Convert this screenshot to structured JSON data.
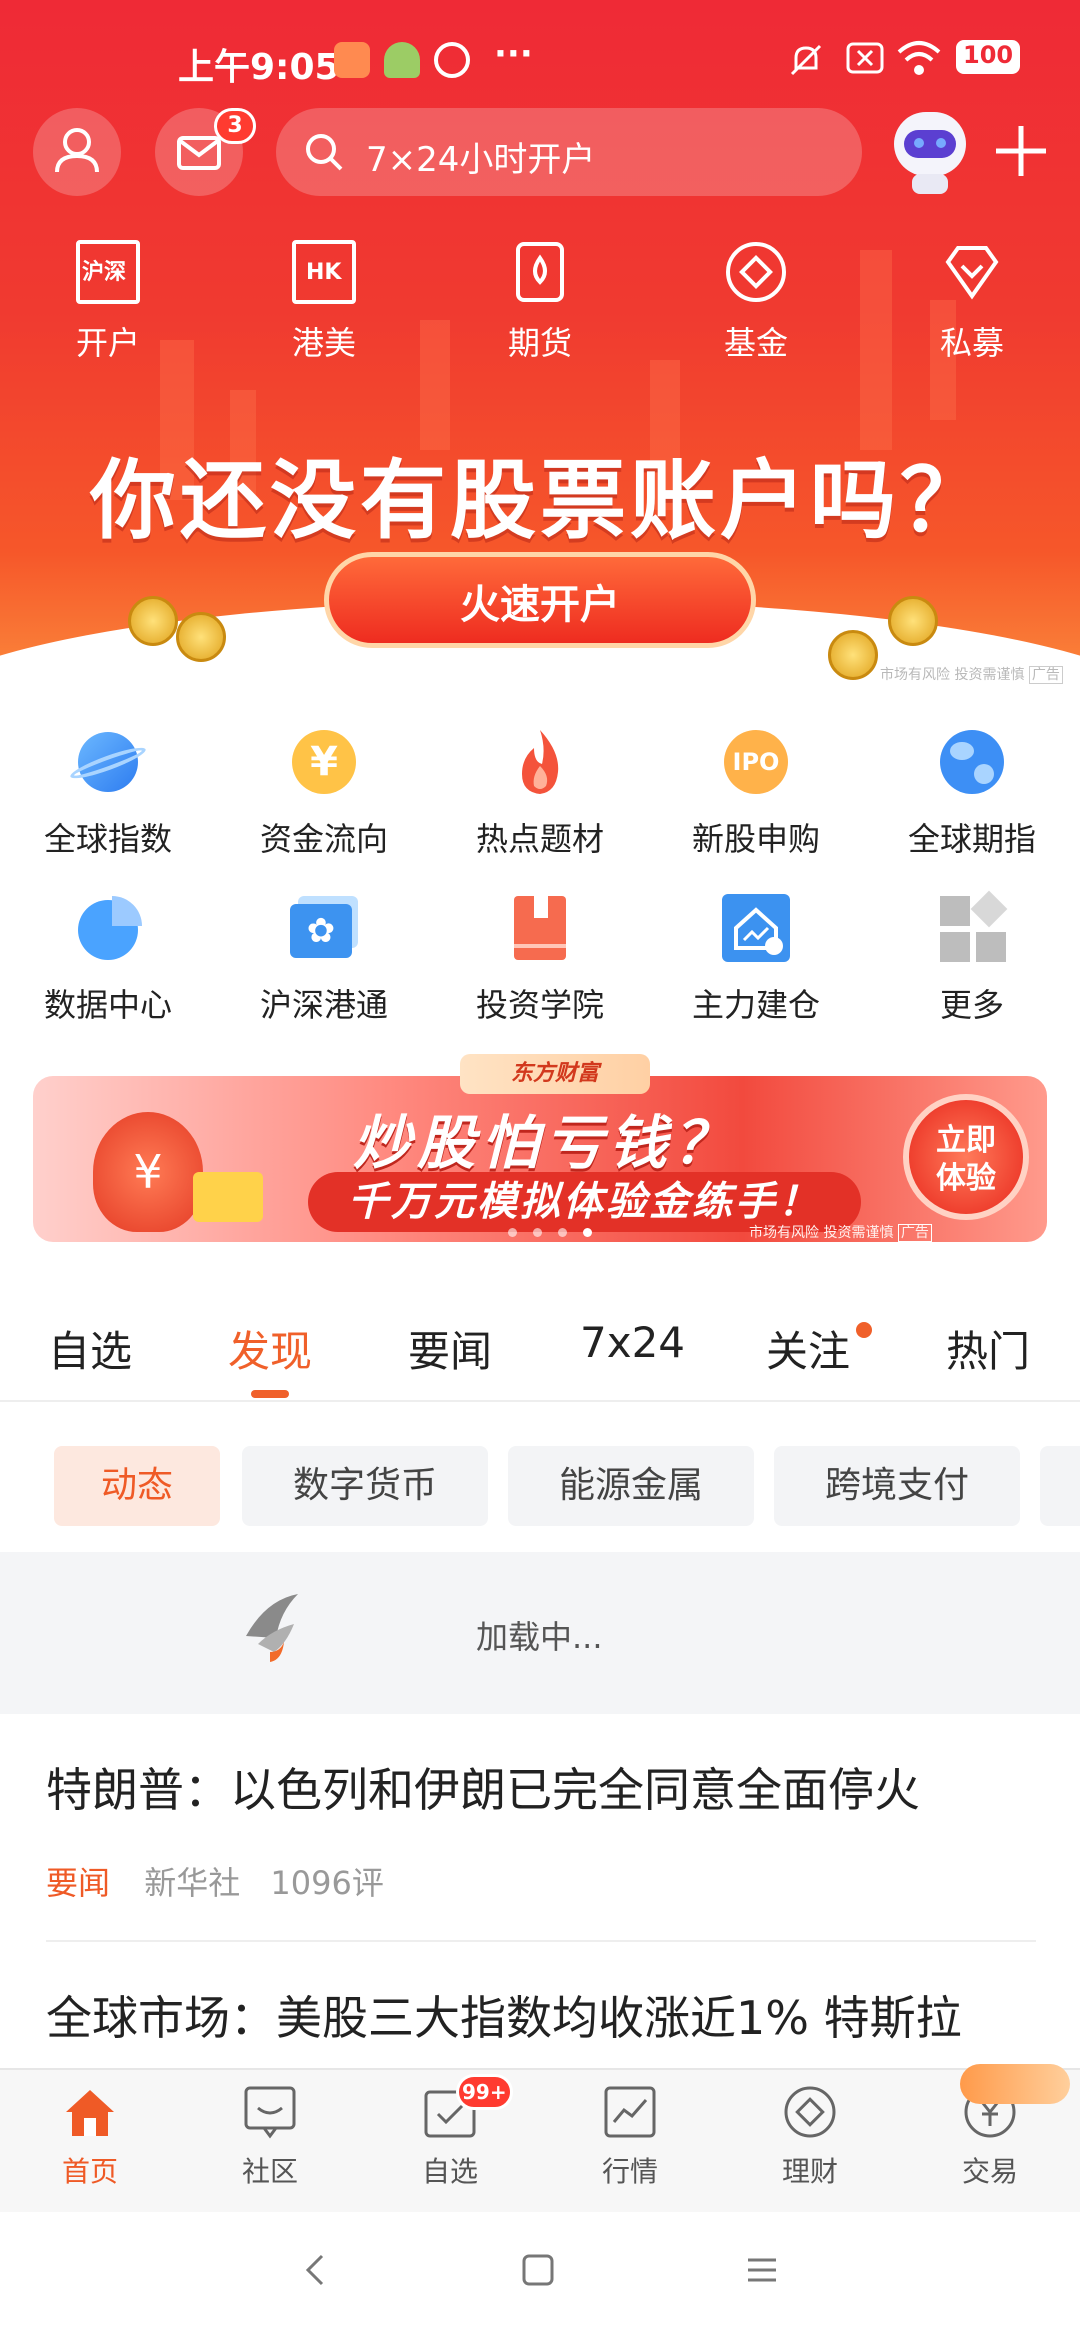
{
  "status_bar": {
    "time": "上午9:05",
    "dots": "···",
    "battery": "100"
  },
  "top_bar": {
    "mail_badge": "3",
    "search_placeholder": "7×24小时开户"
  },
  "quick_entries": [
    {
      "label": "开户",
      "icon": "sh-sz-account-icon",
      "icon_text": "沪深"
    },
    {
      "label": "港美",
      "icon": "hk-us-icon",
      "icon_text": "HK"
    },
    {
      "label": "期货",
      "icon": "futures-icon"
    },
    {
      "label": "基金",
      "icon": "fund-icon"
    },
    {
      "label": "私募",
      "icon": "private-fund-icon"
    }
  ],
  "hero_banner": {
    "title": "你还没有股票账户吗？",
    "button": "火速开户",
    "disclaimer": "市场有风险 投资需谨慎",
    "ad_label": "广告"
  },
  "icon_grid": [
    {
      "label": "全球指数",
      "icon": "planet-icon"
    },
    {
      "label": "资金流向",
      "icon": "yuan-coin-icon"
    },
    {
      "label": "热点题材",
      "icon": "flame-icon"
    },
    {
      "label": "新股申购",
      "icon": "ipo-icon",
      "icon_text": "IPO"
    },
    {
      "label": "全球期指",
      "icon": "globe-icon"
    },
    {
      "label": "数据中心",
      "icon": "pie-chart-icon"
    },
    {
      "label": "沪深港通",
      "icon": "hk-connect-icon"
    },
    {
      "label": "投资学院",
      "icon": "book-icon"
    },
    {
      "label": "主力建仓",
      "icon": "house-chart-icon"
    },
    {
      "label": "更多",
      "icon": "more-grid-icon"
    }
  ],
  "promo_banner": {
    "brand": "东方财富",
    "title": "炒股怕亏钱？",
    "subtitle": "千万元模拟体验金练手！",
    "button_line1": "立即",
    "button_line2": "体验",
    "disclaimer": "市场有风险 投资需谨慎",
    "ad_label": "广告"
  },
  "tabs": [
    {
      "label": "自选"
    },
    {
      "label": "发现",
      "active": true
    },
    {
      "label": "要闻"
    },
    {
      "label": "7x24"
    },
    {
      "label": "关注",
      "dot": true
    },
    {
      "label": "热门"
    }
  ],
  "chips": [
    {
      "label": "动态",
      "active": true
    },
    {
      "label": "数字货币"
    },
    {
      "label": "能源金属"
    },
    {
      "label": "跨境支付"
    }
  ],
  "loading_text": "加载中...",
  "news": [
    {
      "title": "特朗普：以色列和伊朗已完全同意全面停火",
      "tag": "要闻",
      "source": "新华社",
      "comments": "1096评"
    },
    {
      "title": "全球市场：美股三大指数均收涨近1% 特斯拉"
    }
  ],
  "bottom_nav": [
    {
      "label": "首页",
      "icon": "home-icon",
      "active": true
    },
    {
      "label": "社区",
      "icon": "community-icon"
    },
    {
      "label": "自选",
      "icon": "watchlist-icon",
      "badge": "99+"
    },
    {
      "label": "行情",
      "icon": "market-chart-icon"
    },
    {
      "label": "理财",
      "icon": "wealth-icon"
    },
    {
      "label": "交易",
      "icon": "trade-icon"
    }
  ],
  "colors": {
    "brand_red": "#ef2a36",
    "accent_orange": "#ef5a26",
    "badge_red": "#ff3b30"
  }
}
